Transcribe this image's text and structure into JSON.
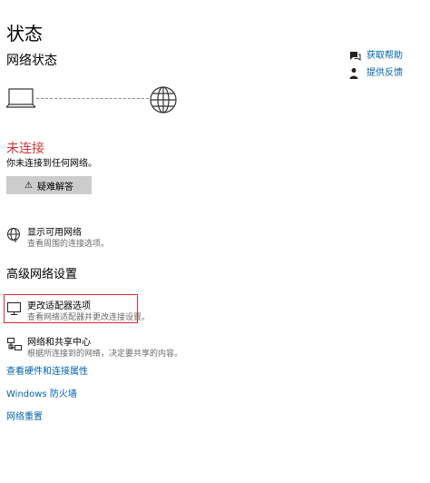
{
  "page": {
    "title": "状态"
  },
  "network_status": {
    "heading": "网络状态",
    "status": "未连接",
    "description": "你未连接到任何网络。",
    "troubleshoot_label": "疑难解答"
  },
  "show_networks": {
    "title": "显示可用网络",
    "description": "查看周围的连接选项。"
  },
  "advanced": {
    "heading": "高级网络设置",
    "items": [
      {
        "title": "更改适配器选项",
        "description": "查看网络适配器并更改连接设置。"
      },
      {
        "title": "网络和共享中心",
        "description": "根据所连接到的网络，决定要共享的内容。"
      }
    ],
    "links": [
      {
        "label": "查看硬件和连接属性"
      },
      {
        "label": "Windows 防火墙"
      },
      {
        "label": "网络重置"
      }
    ]
  },
  "side_panel": {
    "items": [
      {
        "label": "获取帮助",
        "icon": "help-chat-icon"
      },
      {
        "label": "提供反馈",
        "icon": "feedback-person-icon"
      }
    ]
  },
  "colors": {
    "status_red": "#d13438",
    "link_blue": "#0063b1",
    "button_gray": "#cccccc",
    "highlight_red": "#e0292e"
  }
}
